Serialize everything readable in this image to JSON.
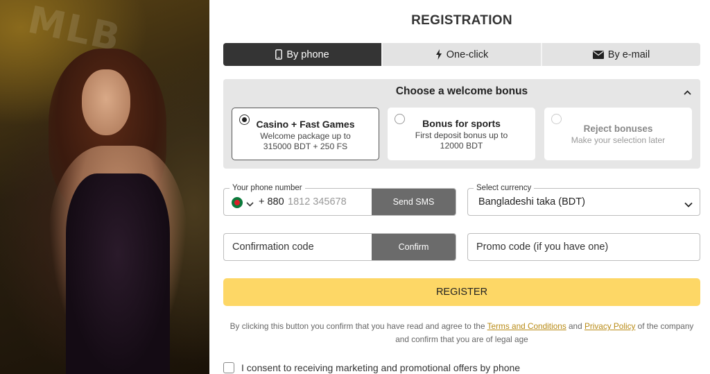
{
  "promo": {
    "logo_text": "MLB"
  },
  "title": "REGISTRATION",
  "tabs": [
    {
      "label": "By phone",
      "icon": "phone-icon",
      "active": true
    },
    {
      "label": "One-click",
      "icon": "lightning-icon",
      "active": false
    },
    {
      "label": "By e-mail",
      "icon": "envelope-icon",
      "active": false
    }
  ],
  "bonus": {
    "heading": "Choose a welcome bonus",
    "options": [
      {
        "name": "Casino + Fast Games",
        "description": "Welcome package up to 315000 BDT + 250 FS",
        "selected": true
      },
      {
        "name": "Bonus for sports",
        "description": "First deposit bonus up to 12000 BDT",
        "selected": false
      },
      {
        "name": "Reject bonuses",
        "description": "Make your selection later",
        "selected": false
      }
    ]
  },
  "phone": {
    "label": "Your phone number",
    "country": "Bangladesh flag",
    "dial_code": "+ 880",
    "placeholder": "1812 345678",
    "send_sms_label": "Send SMS"
  },
  "currency": {
    "label": "Select currency",
    "value": "Bangladeshi taka (BDT)"
  },
  "confirmation": {
    "placeholder": "Confirmation code",
    "button_label": "Confirm"
  },
  "promo_code": {
    "placeholder": "Promo code (if you have one)"
  },
  "register_label": "REGISTER",
  "terms": {
    "prefix": "By clicking this button you confirm that you have read and agree to the",
    "terms_link": "Terms and Conditions",
    "and": "and",
    "privacy_link": "Privacy Policy",
    "suffix": "of the company and confirm that you are of legal age"
  },
  "consent_label": "I consent to receiving marketing and promotional offers by phone",
  "colors": {
    "accent": "#fdd766",
    "tab_active": "#343434",
    "button_grey": "#6b6b6b",
    "link": "#b88a14"
  }
}
